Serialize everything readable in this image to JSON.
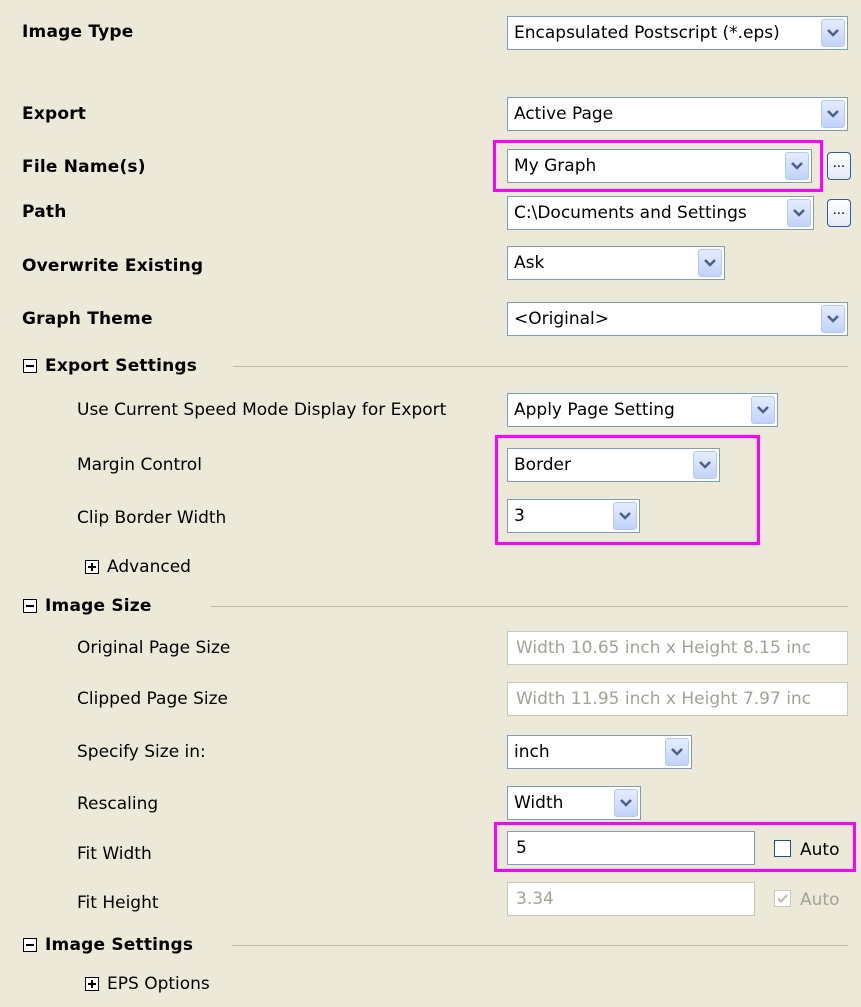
{
  "rows": {
    "image_type": {
      "label": "Image Type",
      "value": "Encapsulated Postscript (*.eps)"
    },
    "export": {
      "label": "Export",
      "value": "Active Page"
    },
    "file_names": {
      "label": "File Name(s)",
      "value": "My Graph",
      "browse": "..."
    },
    "path": {
      "label": "Path",
      "value": "C:\\Documents and Settings",
      "browse": "..."
    },
    "overwrite": {
      "label": "Overwrite Existing",
      "value": "Ask"
    },
    "graph_theme": {
      "label": "Graph Theme",
      "value": "<Original>"
    }
  },
  "export_settings": {
    "title": "Export Settings",
    "speed_mode": {
      "label": "Use Current Speed Mode Display for Export",
      "value": "Apply Page Setting"
    },
    "margin_control": {
      "label": "Margin Control",
      "value": "Border"
    },
    "clip_border_width": {
      "label": "Clip Border Width",
      "value": "3"
    },
    "advanced": {
      "label": "Advanced"
    }
  },
  "image_size": {
    "title": "Image Size",
    "original_page_size": {
      "label": "Original Page Size",
      "value": "Width 10.65 inch x Height 8.15 inc"
    },
    "clipped_page_size": {
      "label": "Clipped Page Size",
      "value": "Width 11.95 inch x Height 7.97 inc"
    },
    "specify_size_in": {
      "label": "Specify Size in:",
      "value": "inch"
    },
    "rescaling": {
      "label": "Rescaling",
      "value": "Width"
    },
    "fit_width": {
      "label": "Fit Width",
      "value": "5",
      "auto_label": "Auto",
      "auto_checked": false
    },
    "fit_height": {
      "label": "Fit Height",
      "value": "3.34",
      "auto_label": "Auto",
      "auto_checked": true
    }
  },
  "image_settings": {
    "title": "Image Settings",
    "eps_options": {
      "label": "EPS Options"
    }
  },
  "colors": {
    "background": "#ece9d8",
    "highlight": "#ff00ff",
    "field_border": "#7f9db9",
    "disabled_text": "#a4a195"
  }
}
